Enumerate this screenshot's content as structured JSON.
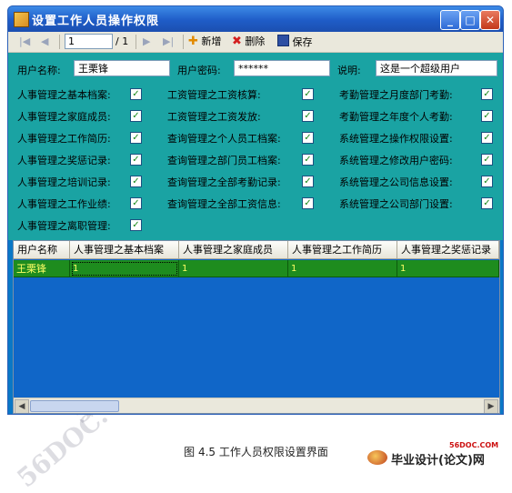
{
  "window": {
    "title": "设置工作人员操作权限",
    "controls": {
      "minimize": "_",
      "maximize": "□",
      "close": "✕"
    }
  },
  "toolbar": {
    "first": "|◀",
    "prev": "◀",
    "position": "1",
    "total": "/ 1",
    "next": "▶",
    "last": "▶|",
    "add_label": "新增",
    "delete_label": "删除",
    "save_label": "保存"
  },
  "form": {
    "username_label": "用户名称:",
    "username_value": "王栗锋",
    "password_label": "用户密码:",
    "password_value": "******",
    "note_label": "说明:",
    "note_value": "这是一个超级用户",
    "permissions": [
      {
        "label": "人事管理之基本档案:",
        "checked": true
      },
      {
        "label": "人事管理之家庭成员:",
        "checked": true
      },
      {
        "label": "人事管理之工作简历:",
        "checked": true
      },
      {
        "label": "人事管理之奖惩记录:",
        "checked": true
      },
      {
        "label": "人事管理之培训记录:",
        "checked": true
      },
      {
        "label": "人事管理之工作业绩:",
        "checked": true
      },
      {
        "label": "人事管理之离职管理:",
        "checked": true
      },
      {
        "label": "工资管理之工资核算:",
        "checked": true
      },
      {
        "label": "工资管理之工资发放:",
        "checked": true
      },
      {
        "label": "查询管理之个人员工档案:",
        "checked": true
      },
      {
        "label": "查询管理之部门员工档案:",
        "checked": true
      },
      {
        "label": "查询管理之全部考勤记录:",
        "checked": true
      },
      {
        "label": "查询管理之全部工资信息:",
        "checked": true
      },
      {
        "label": "考勤管理之月度部门考勤:",
        "checked": true
      },
      {
        "label": "考勤管理之年度个人考勤:",
        "checked": true
      },
      {
        "label": "系统管理之操作权限设置:",
        "checked": true
      },
      {
        "label": "系统管理之修改用户密码:",
        "checked": true
      },
      {
        "label": "系统管理之公司信息设置:",
        "checked": true
      },
      {
        "label": "系统管理之公司部门设置:",
        "checked": true
      }
    ],
    "check_glyph": "✓"
  },
  "grid": {
    "columns": [
      "用户名称",
      "人事管理之基本档案",
      "人事管理之家庭成员",
      "人事管理之工作简历",
      "人事管理之奖惩记录"
    ],
    "rows": [
      [
        "王栗锋",
        "1",
        "1",
        "1",
        "1"
      ]
    ],
    "row_color": "#1e8c1e"
  },
  "scrollbar": {
    "left": "◀",
    "right": "▶"
  },
  "caption": "图 4.5  工作人员权限设置界面",
  "site_logo": {
    "text": "毕业设计(论文)网",
    "url": "56DOC.COM"
  },
  "watermark": "56DOC.COM"
}
